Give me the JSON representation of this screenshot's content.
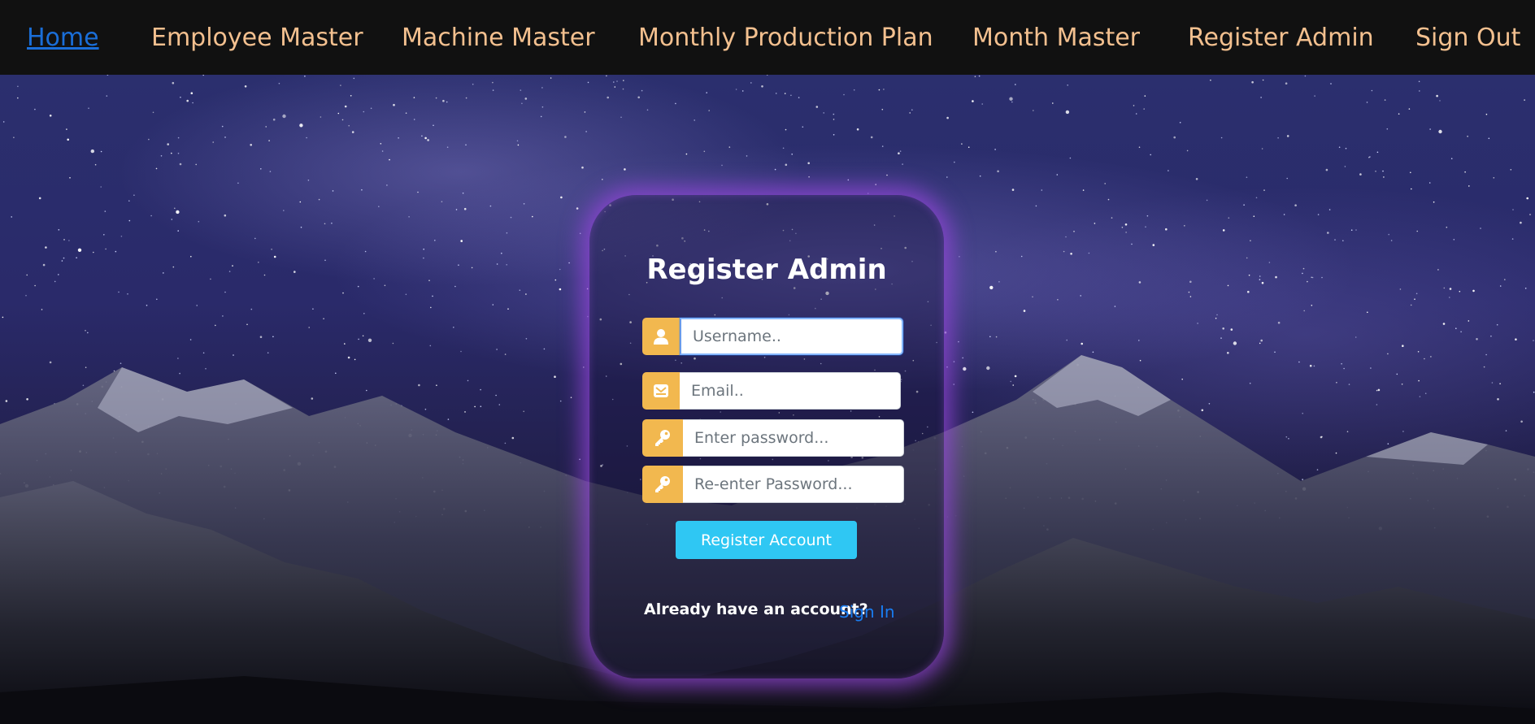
{
  "nav": {
    "items": [
      {
        "label": "Home",
        "active": true
      },
      {
        "label": "Employee Master",
        "active": false
      },
      {
        "label": "Machine Master",
        "active": false
      },
      {
        "label": "Monthly Production Plan",
        "active": false
      },
      {
        "label": "Month Master",
        "active": false
      },
      {
        "label": "Register Admin",
        "active": false
      },
      {
        "label": "Sign Out",
        "active": false
      }
    ]
  },
  "form": {
    "title": "Register Admin",
    "fields": [
      {
        "icon": "user-icon",
        "placeholder": "Username..",
        "value": ""
      },
      {
        "icon": "envelope-icon",
        "placeholder": "Email..",
        "value": ""
      },
      {
        "icon": "key-icon",
        "placeholder": "Enter password...",
        "value": ""
      },
      {
        "icon": "key-icon",
        "placeholder": "Re-enter Password...",
        "value": ""
      }
    ],
    "submit_label": "Register Account",
    "already_text": "Already have an account?",
    "signin_label": "Sign In"
  },
  "colors": {
    "nav_bg": "#111111",
    "nav_text": "#f3c08f",
    "nav_active": "#1a6ed8",
    "icon_bg": "#f2b84f",
    "button_bg": "#2fc7f3",
    "link": "#1a7cf0",
    "card_glow": "#9646dc"
  }
}
